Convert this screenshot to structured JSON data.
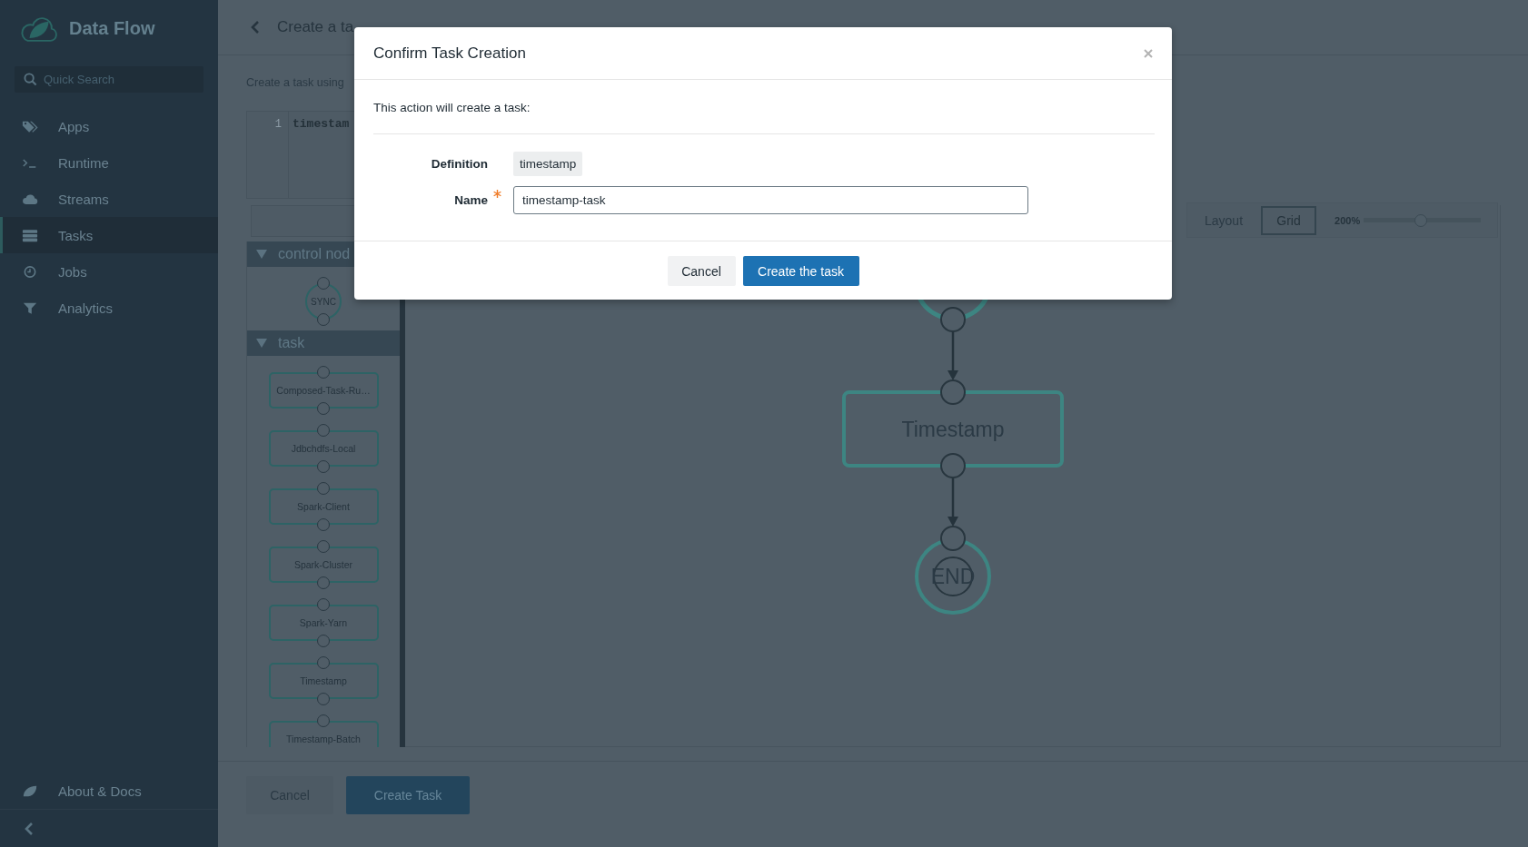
{
  "sidebar": {
    "brand": "Data Flow",
    "search": {
      "placeholder": "Quick Search"
    },
    "items": [
      {
        "label": "Apps",
        "selected": false
      },
      {
        "label": "Runtime",
        "selected": false
      },
      {
        "label": "Streams",
        "selected": false
      },
      {
        "label": "Tasks",
        "selected": true
      },
      {
        "label": "Jobs",
        "selected": false
      },
      {
        "label": "Analytics",
        "selected": false
      }
    ],
    "footer_items": [
      {
        "label": "About & Docs"
      }
    ]
  },
  "header": {
    "title": "Create a ta"
  },
  "page": {
    "intro": "Create a task using",
    "editor": {
      "lines": [
        {
          "number": "1",
          "text": "timestam"
        }
      ]
    }
  },
  "palette": {
    "groups": [
      {
        "title": "control nod",
        "expanded": true,
        "nodes": [
          {
            "kind": "sync",
            "label": "SYNC"
          }
        ]
      },
      {
        "title": "task",
        "expanded": true,
        "nodes": [
          {
            "kind": "task",
            "label": "Composed-Task-Ru…"
          },
          {
            "kind": "task",
            "label": "Jdbchdfs-Local"
          },
          {
            "kind": "task",
            "label": "Spark-Client"
          },
          {
            "kind": "task",
            "label": "Spark-Cluster"
          },
          {
            "kind": "task",
            "label": "Spark-Yarn"
          },
          {
            "kind": "task",
            "label": "Timestamp"
          },
          {
            "kind": "task",
            "label": "Timestamp-Batch"
          }
        ]
      }
    ]
  },
  "canvas": {
    "toolbar": {
      "layout_label": "Layout",
      "layout_button": "Grid",
      "zoom": {
        "reading": "200%",
        "level": 0.49
      }
    },
    "nodes": [
      {
        "kind": "start"
      },
      {
        "kind": "task",
        "label": "Timestamp"
      },
      {
        "kind": "end",
        "label": "END"
      }
    ]
  },
  "footer": {
    "buttons": [
      {
        "kind": "secondary",
        "label": "Cancel"
      },
      {
        "kind": "primary",
        "label": "Create Task"
      }
    ]
  },
  "dialog": {
    "title": "Confirm Task Creation",
    "message": "This action will create a task:",
    "fields": [
      {
        "kind": "readonly",
        "label": "Definition",
        "value": "timestamp"
      },
      {
        "kind": "input",
        "label": "Name",
        "required": true,
        "value": "timestamp-task"
      }
    ],
    "buttons": [
      {
        "kind": "secondary",
        "label": "Cancel"
      },
      {
        "kind": "primary",
        "label": "Create the task"
      }
    ]
  }
}
